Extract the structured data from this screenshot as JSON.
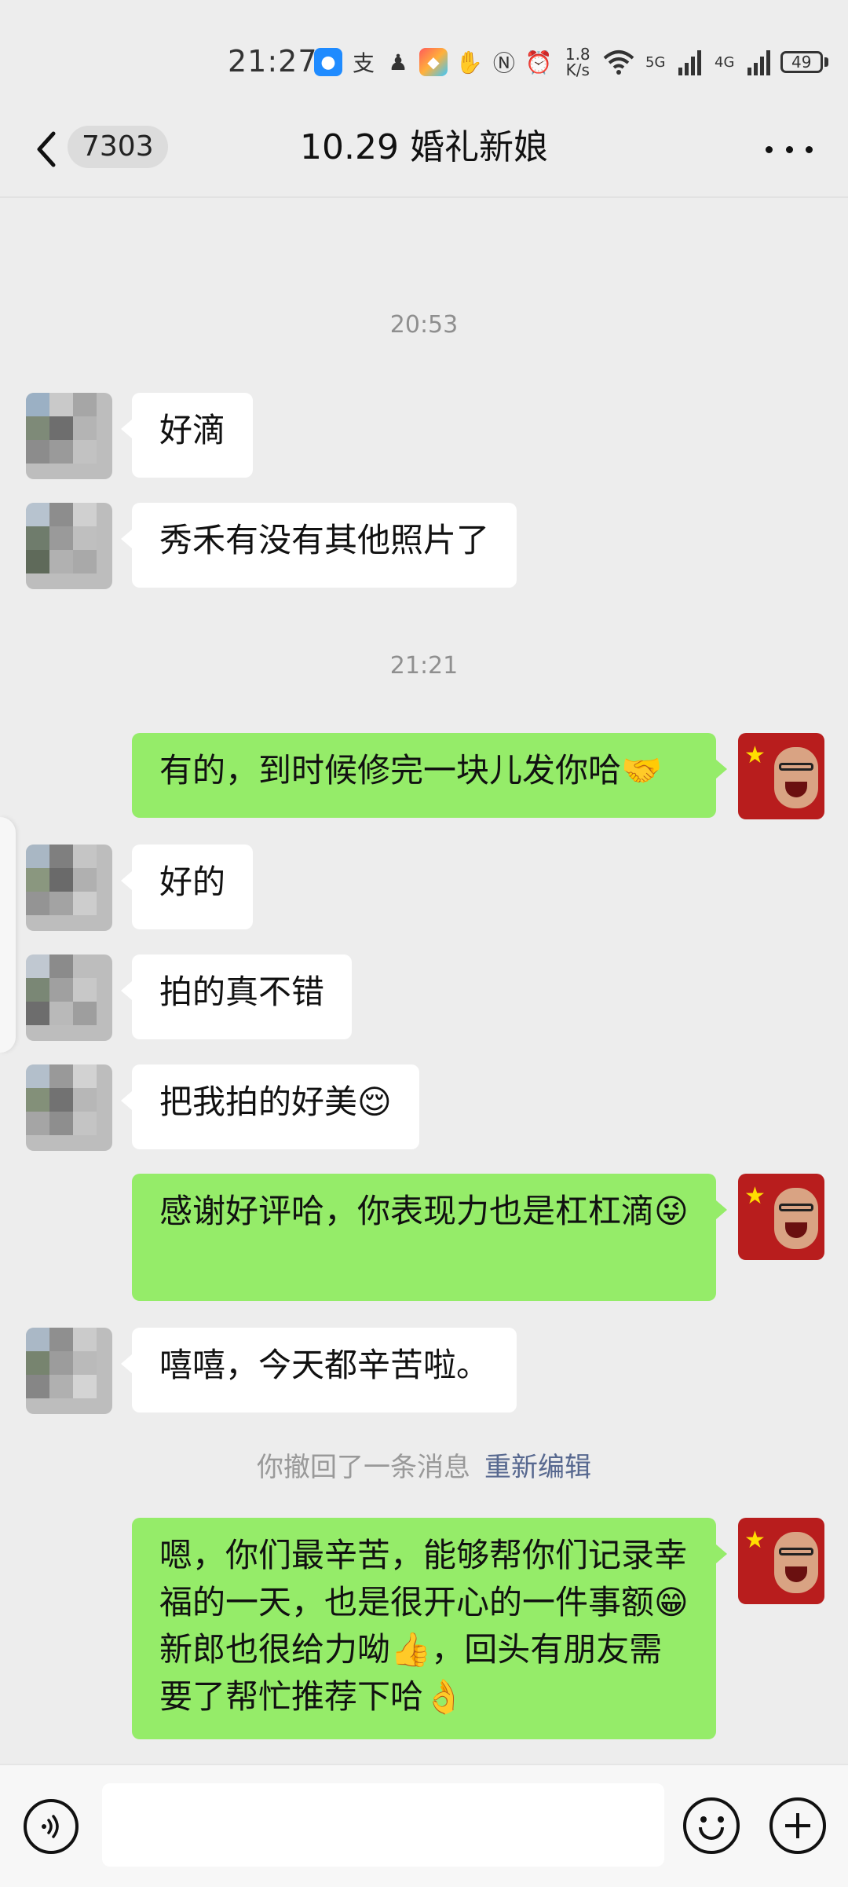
{
  "status_bar": {
    "time": "21:27",
    "net_speed_value": "1.8",
    "net_speed_unit": "K/s",
    "signal_1_label": "5G",
    "signal_2_label": "4G",
    "battery_level": "49",
    "icons": [
      "app-icon",
      "alipay-icon",
      "qq-icon",
      "app-icon",
      "hand-icon",
      "nfc-icon",
      "alarm-icon",
      "wifi-icon",
      "signal-icon",
      "signal-icon",
      "battery-icon"
    ]
  },
  "header": {
    "unread_count": "7303",
    "title": "10.29  婚礼新娘"
  },
  "messages": {
    "ts1": "20:53",
    "m1": "好滴",
    "m2": "秀禾有没有其他照片了",
    "ts2": "21:21",
    "m3": "有的，到时候修完一块儿发你哈🤝",
    "m4": "好的",
    "m5": "拍的真不错",
    "m6": "把我拍的好美😌",
    "m7": "感谢好评哈，你表现力也是杠杠滴😜",
    "m8": "嘻嘻，今天都辛苦啦。",
    "recall_text": "你撤回了一条消息",
    "recall_action": "重新编辑",
    "m9": "嗯，你们最辛苦，能够帮你们记录幸福的一天，也是很开心的一件事额😁新郎也很给力呦👍，回头有朋友需要了帮忙推荐下哈👌"
  },
  "colors": {
    "background": "#ededed",
    "outgoing_bubble": "#95ec69",
    "incoming_bubble": "#ffffff",
    "link": "#57688f"
  }
}
